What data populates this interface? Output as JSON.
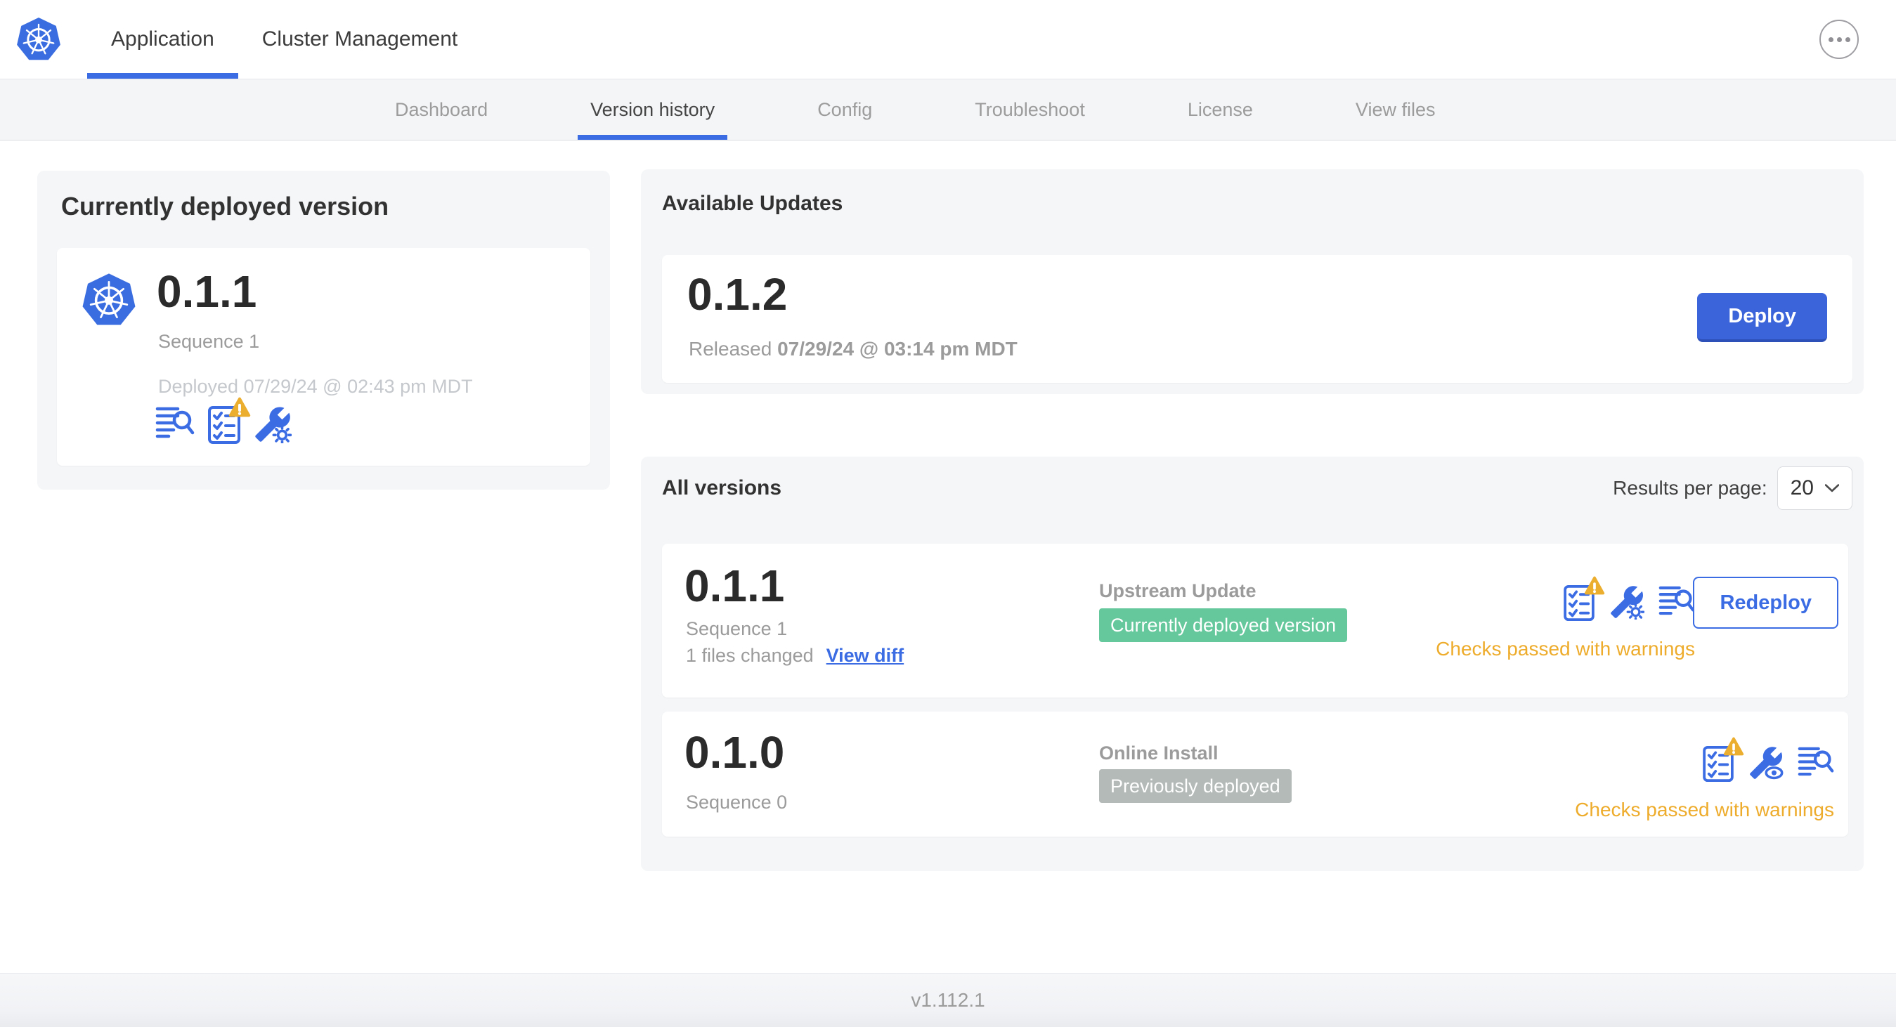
{
  "header": {
    "logo_icon": "kubernetes-logo",
    "tabs": [
      {
        "label": "Application",
        "active": true
      },
      {
        "label": "Cluster Management",
        "active": false
      }
    ],
    "menu_icon": "ellipsis-icon"
  },
  "subnav": {
    "tabs": [
      "Dashboard",
      "Version history",
      "Config",
      "Troubleshoot",
      "License",
      "View files"
    ],
    "active": "Version history"
  },
  "currently_deployed": {
    "title": "Currently deployed version",
    "version": "0.1.1",
    "sequence": "Sequence 1",
    "deployed_timestamp": "Deployed 07/29/24 @ 02:43 pm MDT",
    "icons": [
      "release-notes-icon",
      "preflight-warning-icon",
      "config-gear-icon"
    ]
  },
  "available_updates": {
    "title": "Available Updates",
    "version": "0.1.2",
    "released_label": "Released",
    "released_timestamp": "07/29/24 @ 03:14 pm MDT",
    "deploy_button": "Deploy"
  },
  "all_versions": {
    "title": "All versions",
    "results_per_page_label": "Results per page:",
    "results_per_page_value": "20",
    "rows": [
      {
        "version": "0.1.1",
        "sequence": "Sequence 1",
        "files_changed": "1 files changed",
        "view_diff": "View diff",
        "source": "Upstream Update",
        "badge": "Currently deployed version",
        "badge_color": "green",
        "icons": [
          "preflight-warning-icon",
          "config-gear-icon",
          "release-notes-icon"
        ],
        "action": "Redeploy",
        "status": "Checks passed with warnings"
      },
      {
        "version": "0.1.0",
        "sequence": "Sequence 0",
        "source": "Online Install",
        "badge": "Previously deployed",
        "badge_color": "gray",
        "icons": [
          "preflight-warning-icon",
          "config-view-icon",
          "release-notes-icon"
        ],
        "status": "Checks passed with warnings"
      }
    ]
  },
  "footer": {
    "version": "v1.112.1"
  },
  "colors": {
    "accent_blue": "#3b6ce4",
    "logo_blue": "#3a6de0",
    "deploy_button_blue": "#3c64da",
    "badge_green": "#65c89c",
    "badge_gray": "#b3bab7",
    "warning_amber": "#eeac2c",
    "text_dark": "#323232",
    "text_gray": "#9b9b9b",
    "text_light_gray": "#c5c8cc"
  }
}
